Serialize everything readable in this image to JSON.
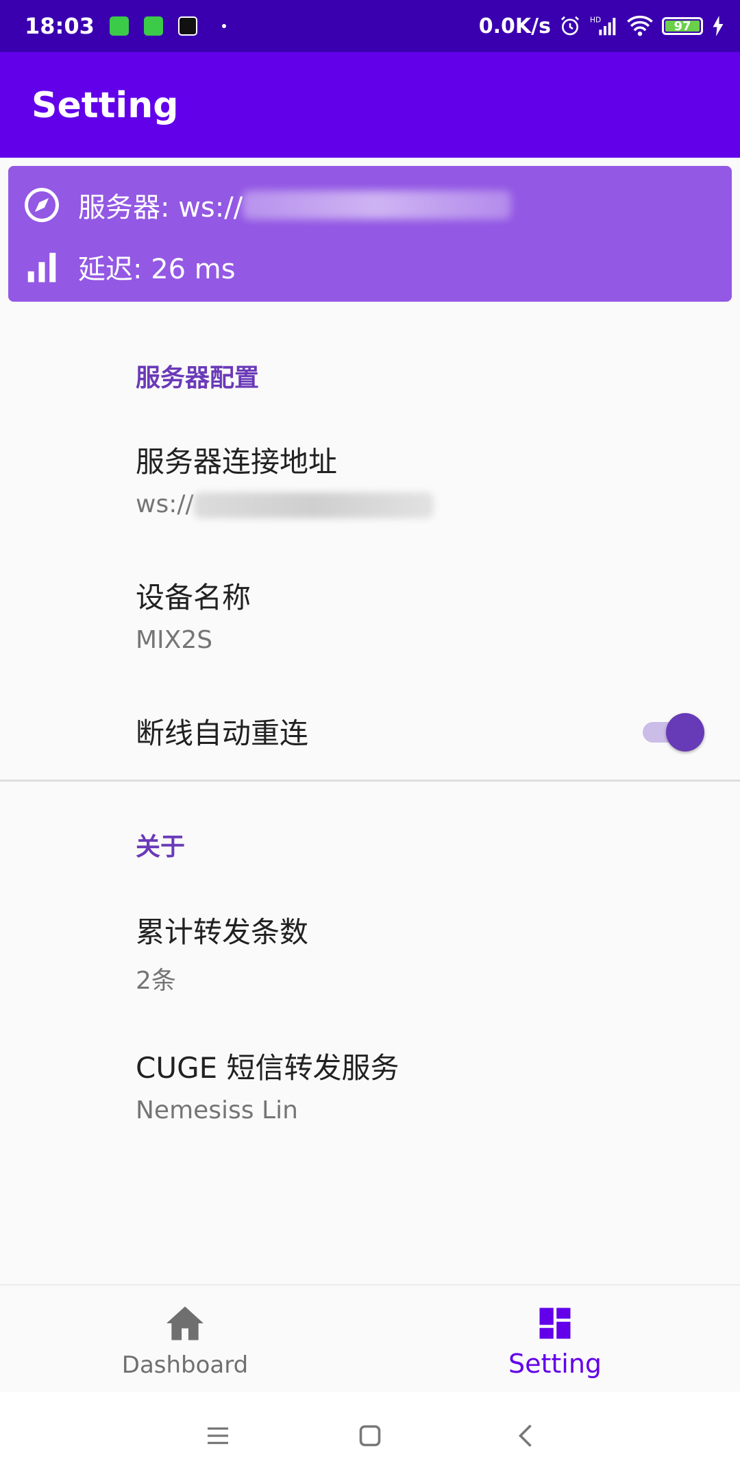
{
  "status_bar": {
    "time": "18:03",
    "net_speed": "0.0K/s",
    "battery": "97",
    "icons": [
      "app-notification-icon",
      "app-notification-icon",
      "tiktok-icon",
      "dot-icon",
      "alarm-icon",
      "hd-signal-icon",
      "wifi-icon",
      "battery-icon",
      "charging-icon"
    ]
  },
  "app_bar": {
    "title": "Setting"
  },
  "server_card": {
    "server_prefix": "服务器: ws://",
    "latency": "延迟: 26 ms",
    "colors": {
      "background": "#9358e4"
    }
  },
  "sections": {
    "server_config": {
      "title": "服务器配置",
      "address_title": "服务器连接地址",
      "address_value_prefix": "ws://",
      "device_title": "设备名称",
      "device_value": "MIX2S",
      "reconnect_title": "断线自动重连",
      "reconnect_enabled": true
    },
    "about": {
      "title": "关于",
      "count_title": "累计转发条数",
      "count_value": "2条",
      "app_title": "CUGE 短信转发服务",
      "app_author": "Nemesiss Lin"
    }
  },
  "bottom_nav": {
    "items": [
      {
        "label": "Dashboard",
        "icon": "home-icon",
        "active": false
      },
      {
        "label": "Setting",
        "icon": "dashboard-icon",
        "active": true
      }
    ]
  },
  "colors": {
    "primary": "#6200ea",
    "status_bar": "#3a00b0",
    "accent": "#673ab7"
  }
}
